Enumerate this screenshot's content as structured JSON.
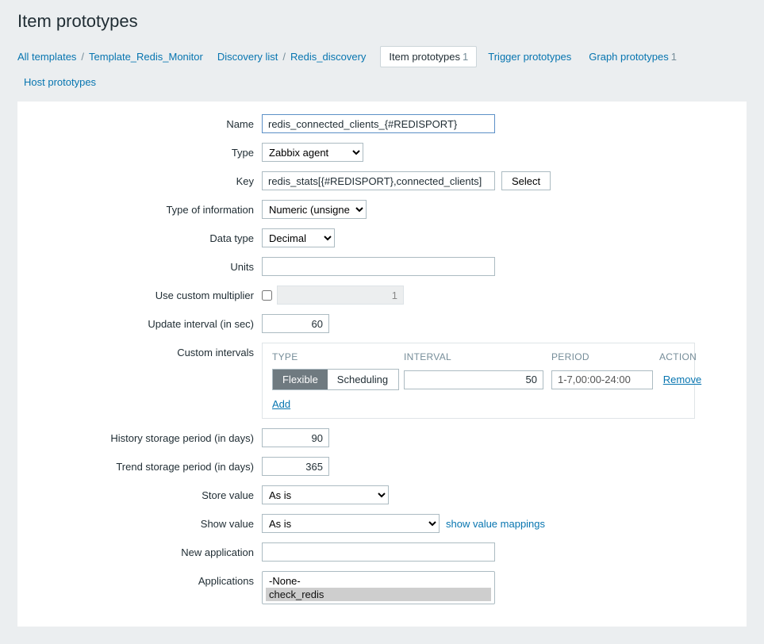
{
  "pageTitle": "Item prototypes",
  "breadcrumb": {
    "allTemplates": "All templates",
    "template": "Template_Redis_Monitor",
    "discoveryList": "Discovery list",
    "discovery": "Redis_discovery",
    "itemPrototypes": "Item prototypes",
    "itemPrototypesCount": "1",
    "triggerPrototypes": "Trigger prototypes",
    "graphPrototypes": "Graph prototypes",
    "graphPrototypesCount": "1",
    "hostPrototypes": "Host prototypes"
  },
  "labels": {
    "name": "Name",
    "type": "Type",
    "key": "Key",
    "typeInfo": "Type of information",
    "dataType": "Data type",
    "units": "Units",
    "useMultiplier": "Use custom multiplier",
    "updateInterval": "Update interval (in sec)",
    "customIntervals": "Custom intervals",
    "historyStorage": "History storage period (in days)",
    "trendStorage": "Trend storage period (in days)",
    "storeValue": "Store value",
    "showValue": "Show value",
    "newApplication": "New application",
    "applications": "Applications"
  },
  "fields": {
    "name": "redis_connected_clients_{#REDISPORT}",
    "type": "Zabbix agent",
    "key": "redis_stats[{#REDISPORT},connected_clients]",
    "typeInfo": "Numeric (unsigned)",
    "dataType": "Decimal",
    "units": "",
    "multiplierValue": "1",
    "updateInterval": "60",
    "ci": {
      "hdrType": "TYPE",
      "hdrInterval": "INTERVAL",
      "hdrPeriod": "PERIOD",
      "hdrAction": "ACTION",
      "flexible": "Flexible",
      "scheduling": "Scheduling",
      "intervalVal": "50",
      "periodVal": "1-7,00:00-24:00",
      "remove": "Remove",
      "add": "Add"
    },
    "history": "90",
    "trend": "365",
    "storeValue": "As is",
    "showValue": "As is",
    "showValueMappings": "show value mappings",
    "newApplication": "",
    "appsNone": "-None-",
    "appsCheckRedis": "check_redis"
  },
  "buttons": {
    "select": "Select"
  }
}
